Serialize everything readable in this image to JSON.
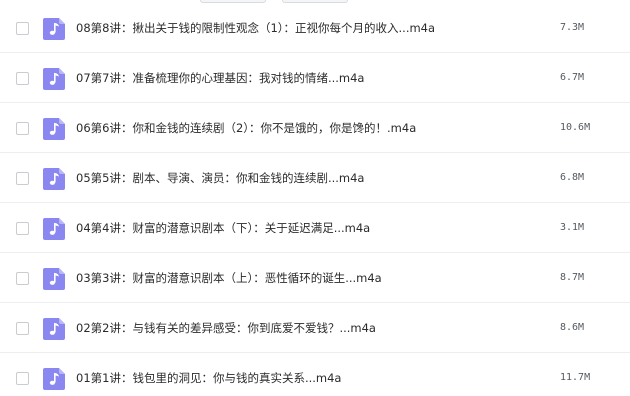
{
  "file_list": {
    "items": [
      {
        "name": "08第8讲：揪出关于钱的限制性观念（1）：正视你每个月的收入...m4a",
        "size": "7.3M",
        "icon": "audio-file-icon",
        "checked": false
      },
      {
        "name": "07第7讲：准备梳理你的心理基因：我对钱的情绪...m4a",
        "size": "6.7M",
        "icon": "audio-file-icon",
        "checked": false
      },
      {
        "name": "06第6讲：你和金钱的连续剧（2）：你不是饿的，你是馋的！.m4a",
        "size": "10.6M",
        "icon": "audio-file-icon",
        "checked": false
      },
      {
        "name": "05第5讲：剧本、导演、演员：你和金钱的连续剧...m4a",
        "size": "6.8M",
        "icon": "audio-file-icon",
        "checked": false
      },
      {
        "name": "04第4讲：财富的潜意识剧本（下）：关于延迟满足...m4a",
        "size": "3.1M",
        "icon": "audio-file-icon",
        "checked": false
      },
      {
        "name": "03第3讲：财富的潜意识剧本（上）：恶性循环的诞生...m4a",
        "size": "8.7M",
        "icon": "audio-file-icon",
        "checked": false
      },
      {
        "name": "02第2讲：与钱有关的差异感受：你到底爱不爱钱？...m4a",
        "size": "8.6M",
        "icon": "audio-file-icon",
        "checked": false
      },
      {
        "name": "01第1讲：钱包里的洞见：你与钱的真实关系...m4a",
        "size": "11.7M",
        "icon": "audio-file-icon",
        "checked": false
      }
    ]
  },
  "colors": {
    "icon_bg": "#8a87f0",
    "icon_fold": "#b9b7f7",
    "icon_glyph": "#ffffff",
    "row_divider": "#eceef1",
    "text": "#2b2b2b",
    "size_text": "#555a60"
  }
}
